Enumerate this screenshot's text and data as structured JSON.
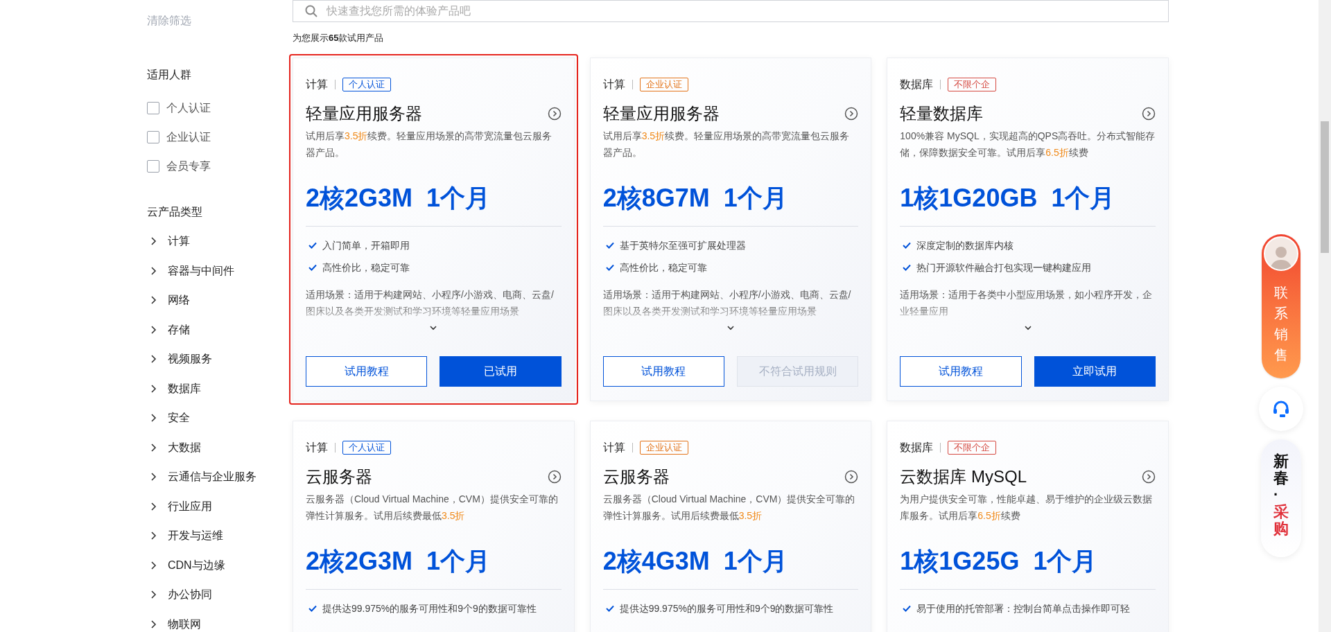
{
  "sidebar": {
    "clear_filters": "清除筛选",
    "audience": {
      "title": "适用人群",
      "options": [
        {
          "label": "个人认证",
          "checked": false
        },
        {
          "label": "企业认证",
          "checked": false
        },
        {
          "label": "会员专享",
          "checked": false
        }
      ]
    },
    "product_types": {
      "title": "云产品类型",
      "items": [
        {
          "label": "计算",
          "expanded": false
        },
        {
          "label": "容器与中间件",
          "expanded": false
        },
        {
          "label": "网络",
          "expanded": false
        },
        {
          "label": "存储",
          "expanded": false
        },
        {
          "label": "视频服务",
          "expanded": false
        },
        {
          "label": "数据库",
          "expanded": false
        },
        {
          "label": "安全",
          "expanded": false
        },
        {
          "label": "大数据",
          "expanded": false
        },
        {
          "label": "云通信与企业服务",
          "expanded": false
        },
        {
          "label": "行业应用",
          "expanded": false
        },
        {
          "label": "开发与运维",
          "expanded": false
        },
        {
          "label": "CDN与边缘",
          "expanded": false
        },
        {
          "label": "办公协同",
          "expanded": false
        },
        {
          "label": "物联网",
          "expanded": false
        }
      ]
    }
  },
  "search": {
    "placeholder": "快速查找您所需的体验产品吧"
  },
  "result_count": "为您展示**65**款试用产品",
  "cards": [
    {
      "highlighted": true,
      "category": "计算",
      "tag": {
        "text": "个人认证",
        "color": "#0052d9"
      },
      "title": "轻量应用服务器",
      "description": [
        {
          "text": "试用后享",
          "highlight": false
        },
        {
          "text": "3.5折",
          "highlight": true
        },
        {
          "text": "续费。轻量应用场景的高带宽流量包云服务器产品。",
          "highlight": false
        }
      ],
      "spec": "2核2G3M  1个月",
      "features": [
        "入门简单，开箱即用",
        "高性价比，稳定可靠"
      ],
      "scenario": "适用场景：适用于构建网站、小程序/小游戏、电商、云盘/图床以及各类开发测试和学习环境等轻量应用场景",
      "buttons": [
        {
          "label": "试用教程",
          "kind": "outline"
        },
        {
          "label": "已试用",
          "kind": "primary"
        }
      ]
    },
    {
      "highlighted": false,
      "category": "计算",
      "tag": {
        "text": "企业认证",
        "color": "#e37318"
      },
      "title": "轻量应用服务器",
      "description": [
        {
          "text": "试用后享",
          "highlight": false
        },
        {
          "text": "3.5折",
          "highlight": true
        },
        {
          "text": "续费。轻量应用场景的高带宽流量包云服务器产品。",
          "highlight": false
        }
      ],
      "spec": "2核8G7M  1个月",
      "features": [
        "基于英特尔至强可扩展处理器",
        "高性价比，稳定可靠"
      ],
      "scenario": "适用场景：适用于构建网站、小程序/小游戏、电商、云盘/图床以及各类开发测试和学习环境等轻量应用场景",
      "buttons": [
        {
          "label": "试用教程",
          "kind": "outline"
        },
        {
          "label": "不符合试用规则",
          "kind": "disabled"
        }
      ]
    },
    {
      "highlighted": false,
      "category": "数据库",
      "tag": {
        "text": "不限个企",
        "color": "#d54941"
      },
      "title": "轻量数据库",
      "description": [
        {
          "text": "100%兼容 MySQL，实现超高的QPS高吞吐。分布式智能存储，保障数据安全可靠。试用后享",
          "highlight": false
        },
        {
          "text": "6.5折",
          "highlight": true
        },
        {
          "text": "续费",
          "highlight": false
        }
      ],
      "spec": "1核1G20GB  1个月",
      "features": [
        "深度定制的数据库内核",
        "热门开源软件融合打包实现一键构建应用"
      ],
      "scenario": "适用场景：适用于各类中小型应用场景，如小程序开发，企业轻量应用",
      "buttons": [
        {
          "label": "试用教程",
          "kind": "outline"
        },
        {
          "label": "立即试用",
          "kind": "primary"
        }
      ]
    },
    {
      "highlighted": false,
      "category": "计算",
      "tag": {
        "text": "个人认证",
        "color": "#0052d9"
      },
      "title": "云服务器",
      "description": [
        {
          "text": "云服务器（Cloud Virtual Machine，CVM）提供安全可靠的弹性计算服务。试用后续费最低",
          "highlight": false
        },
        {
          "text": "3.5折",
          "highlight": true
        }
      ],
      "spec": "2核2G3M  1个月",
      "features": [
        "提供达99.975%的服务可用性和9个9的数据可靠性"
      ]
    },
    {
      "highlighted": false,
      "category": "计算",
      "tag": {
        "text": "企业认证",
        "color": "#e37318"
      },
      "title": "云服务器",
      "description": [
        {
          "text": "云服务器（Cloud Virtual Machine，CVM）提供安全可靠的弹性计算服务。试用后续费最低",
          "highlight": false
        },
        {
          "text": "3.5折",
          "highlight": true
        }
      ],
      "spec": "2核4G3M  1个月",
      "features": [
        "提供达99.975%的服务可用性和9个9的数据可靠性"
      ]
    },
    {
      "highlighted": false,
      "category": "数据库",
      "tag": {
        "text": "不限个企",
        "color": "#d54941"
      },
      "title": "云数据库 MySQL",
      "description": [
        {
          "text": "为用户提供安全可靠，性能卓越、易于维护的企业级云数据库服务。试用后享",
          "highlight": false
        },
        {
          "text": "6.5折",
          "highlight": true
        },
        {
          "text": "续费",
          "highlight": false
        }
      ],
      "spec": "1核1G25G  1个月",
      "features": [
        "易于使用的托管部署：控制台简单点击操作即可轻"
      ]
    }
  ],
  "floating": {
    "contact": "联系销售",
    "promo": [
      {
        "text": "新春",
        "accent": false
      },
      {
        "text": "·",
        "accent": false
      },
      {
        "text": "采购",
        "accent": true
      }
    ]
  }
}
